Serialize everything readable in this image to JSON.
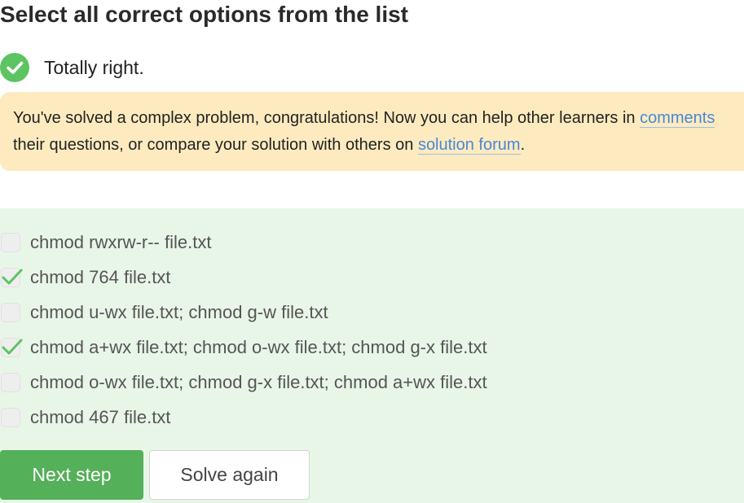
{
  "heading": "Select all correct options from the list",
  "result": {
    "icon": "check-circle-icon",
    "text": "Totally right."
  },
  "note": {
    "text_1": "You've solved a complex problem, congratulations! Now you can help other learners in ",
    "link_1": "comments",
    "text_2": "their questions, or compare your solution with others on ",
    "link_2": "solution forum",
    "text_3": "."
  },
  "options": [
    {
      "label": "chmod rwxrw-r-- file.txt",
      "checked": false
    },
    {
      "label": "chmod 764 file.txt",
      "checked": true
    },
    {
      "label": "chmod u-wx file.txt; chmod g-w file.txt",
      "checked": false
    },
    {
      "label": "chmod a+wx file.txt; chmod o-wx file.txt; chmod g-x file.txt",
      "checked": true
    },
    {
      "label": "chmod o-wx file.txt; chmod g-x file.txt; chmod a+wx file.txt",
      "checked": false
    },
    {
      "label": "chmod 467 file.txt",
      "checked": false
    }
  ],
  "buttons": {
    "next": "Next step",
    "solve_again": "Solve again"
  },
  "colors": {
    "success": "#5cc461",
    "check_mark": "#5cc461",
    "answer_background": "#e8f6e7",
    "note_background": "#fdebbf",
    "link": "#4a86d8",
    "primary_button": "#54b059"
  }
}
